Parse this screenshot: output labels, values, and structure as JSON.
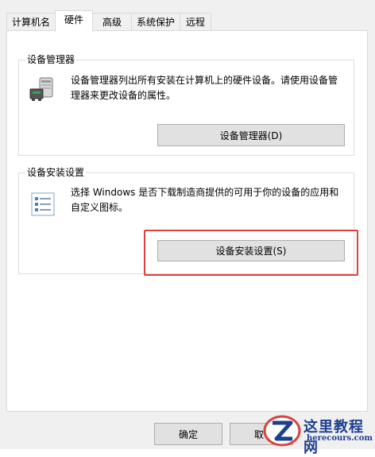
{
  "tabs": [
    {
      "label": "计算机名",
      "active": false
    },
    {
      "label": "硬件",
      "active": true
    },
    {
      "label": "高级",
      "active": false
    },
    {
      "label": "系统保护",
      "active": false
    },
    {
      "label": "远程",
      "active": false
    }
  ],
  "device_manager": {
    "title": "设备管理器",
    "description_line1": "设备管理器列出所有安装在计算机上的硬件设备。请使用设备管",
    "description_line2": "理器来更改设备的属性。",
    "button_label": "设备管理器(D)",
    "icon": "device-manager-icon"
  },
  "device_install": {
    "title": "设备安装设置",
    "description_line1": "选择 Windows 是否下载制造商提供的可用于你的设备的应用和",
    "description_line2": "自定义图标。",
    "button_label": "设备安装设置(S)",
    "icon": "checklist-icon"
  },
  "footer": {
    "ok_label": "确定",
    "cancel_label": "取"
  },
  "watermark": {
    "text": "这里教程网",
    "url": "herecours.com"
  },
  "colors": {
    "highlight": "#d9423c",
    "panel": "#ffffff",
    "dialog": "#f0f0f0",
    "watermark": "#1d3f8f"
  }
}
